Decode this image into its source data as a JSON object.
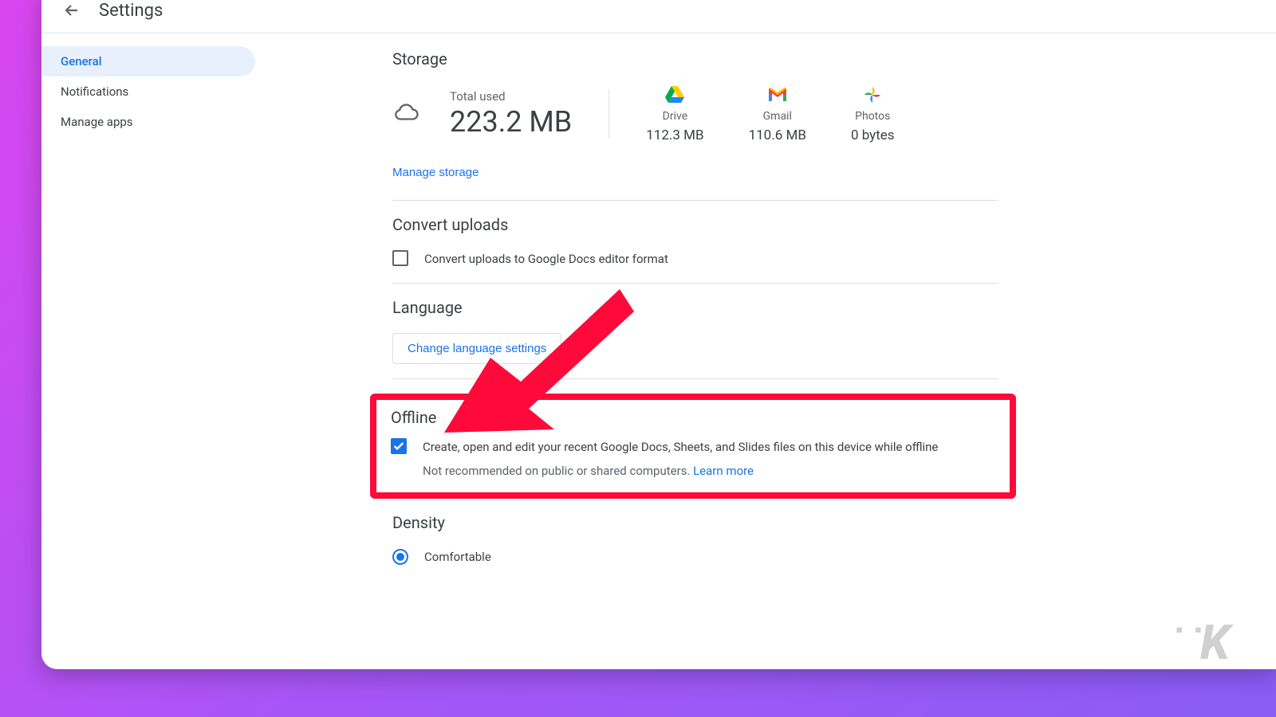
{
  "header": {
    "title": "Settings"
  },
  "sidebar": {
    "items": [
      {
        "label": "General",
        "active": true
      },
      {
        "label": "Notifications",
        "active": false
      },
      {
        "label": "Manage apps",
        "active": false
      }
    ]
  },
  "storage": {
    "title": "Storage",
    "total_label": "Total used",
    "total_value": "223.2 MB",
    "apps": [
      {
        "name": "Drive",
        "size": "112.3 MB"
      },
      {
        "name": "Gmail",
        "size": "110.6 MB"
      },
      {
        "name": "Photos",
        "size": "0 bytes"
      }
    ],
    "manage_label": "Manage storage"
  },
  "convert": {
    "title": "Convert uploads",
    "checkbox_label": "Convert uploads to Google Docs editor format",
    "checked": false
  },
  "language": {
    "title": "Language",
    "button_label": "Change language settings"
  },
  "offline": {
    "title": "Offline",
    "checkbox_label": "Create, open and edit your recent Google Docs, Sheets, and Slides files on this device while offline",
    "sub_text": "Not recommended on public or shared computers. ",
    "learn_more": "Learn more",
    "checked": true
  },
  "density": {
    "title": "Density",
    "options": [
      {
        "label": "Comfortable",
        "selected": true
      }
    ]
  },
  "annotation": {
    "highlight_color": "#fe0a3a",
    "arrow_color": "#fe0a3a"
  },
  "watermark": {
    "text": "K"
  }
}
